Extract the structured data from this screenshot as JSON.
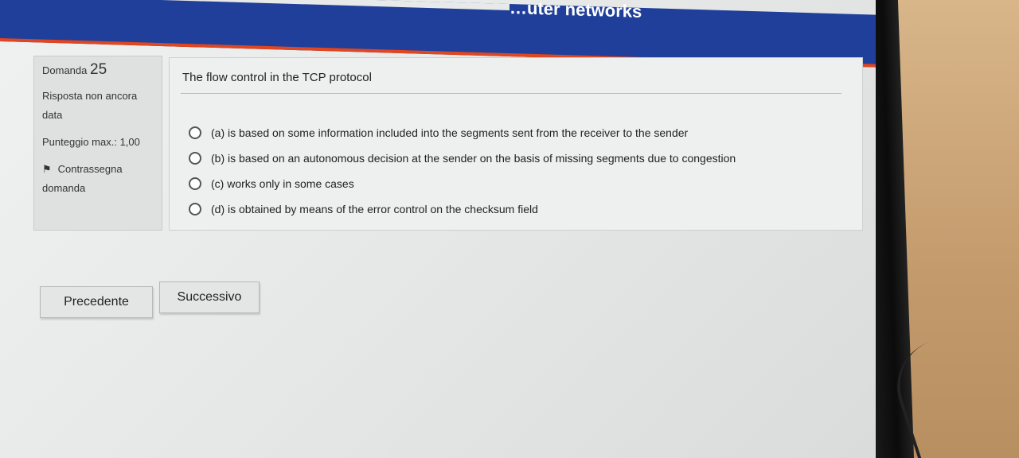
{
  "header": {
    "site_title": "…uter networks"
  },
  "question_info": {
    "label": "Domanda",
    "number": "25",
    "status": "Risposta non ancora data",
    "score_label": "Punteggio max.:",
    "score_value": "1,00",
    "flag_label": "Contrassegna domanda",
    "flag_icon": "flag-icon"
  },
  "question": {
    "text": "The flow control in the TCP protocol",
    "answers": [
      {
        "label": "(a) is based on some information included into the segments sent from the receiver to the sender"
      },
      {
        "label": "(b) is based on an autonomous decision at the sender on the basis of missing segments due to congestion"
      },
      {
        "label": "(c) works only in some cases"
      },
      {
        "label": "(d) is obtained by means of the error control on the checksum field"
      }
    ]
  },
  "navigation": {
    "prev_label": "Precedente",
    "next_label": "Successivo"
  },
  "colors": {
    "header_bg": "#1f3f9a",
    "header_accent": "#e0461f"
  }
}
